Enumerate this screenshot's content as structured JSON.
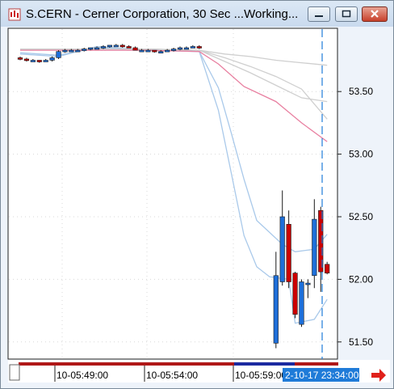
{
  "window": {
    "title": "S.CERN - Cerner Corporation, 30 Sec ...Working...",
    "controls": [
      "minimize",
      "maximize",
      "close"
    ]
  },
  "chart_data": {
    "type": "candlestick",
    "symbol": "S.CERN",
    "interval": "30 Sec",
    "y_ticks": [
      "53.50",
      "53.00",
      "52.50",
      "52.00",
      "51.50"
    ],
    "y_tick_values": [
      53.5,
      53.0,
      52.5,
      52.0,
      51.5
    ],
    "x_ticks": [
      "10-05:49:00",
      "10-05:54:00",
      "10-05:59:00"
    ],
    "cursor_time_label": "2-10-17 23:34:00",
    "ylim": [
      51.3,
      53.9
    ],
    "grid": true,
    "colors": {
      "up": "#1e6fd9",
      "down": "#cc0000",
      "cursor": "#1f7bd8",
      "ma_pink": "#e87fa0",
      "ma_blue": "#a9c9ea",
      "ma_gray": "#cfcfcf"
    },
    "candles": [
      {
        "i": 0,
        "open": 53.77,
        "close": 53.76,
        "high": 53.78,
        "low": 53.75
      },
      {
        "i": 1,
        "open": 53.76,
        "close": 53.75,
        "high": 53.77,
        "low": 53.74
      },
      {
        "i": 2,
        "open": 53.75,
        "close": 53.75,
        "high": 53.76,
        "low": 53.74
      },
      {
        "i": 3,
        "open": 53.75,
        "close": 53.74,
        "high": 53.75,
        "low": 53.73
      },
      {
        "i": 4,
        "open": 53.74,
        "close": 53.75,
        "high": 53.76,
        "low": 53.74
      },
      {
        "i": 5,
        "open": 53.75,
        "close": 53.77,
        "high": 53.78,
        "low": 53.74
      },
      {
        "i": 6,
        "open": 53.77,
        "close": 53.82,
        "high": 53.83,
        "low": 53.76
      },
      {
        "i": 7,
        "open": 53.82,
        "close": 53.83,
        "high": 53.84,
        "low": 53.81
      },
      {
        "i": 8,
        "open": 53.83,
        "close": 53.83,
        "high": 53.84,
        "low": 53.82
      },
      {
        "i": 9,
        "open": 53.83,
        "close": 53.83,
        "high": 53.84,
        "low": 53.83
      },
      {
        "i": 10,
        "open": 53.83,
        "close": 53.84,
        "high": 53.85,
        "low": 53.82
      },
      {
        "i": 11,
        "open": 53.84,
        "close": 53.85,
        "high": 53.85,
        "low": 53.83
      },
      {
        "i": 12,
        "open": 53.85,
        "close": 53.85,
        "high": 53.86,
        "low": 53.84
      },
      {
        "i": 13,
        "open": 53.85,
        "close": 53.86,
        "high": 53.87,
        "low": 53.84
      },
      {
        "i": 14,
        "open": 53.86,
        "close": 53.87,
        "high": 53.87,
        "low": 53.85
      },
      {
        "i": 15,
        "open": 53.87,
        "close": 53.87,
        "high": 53.88,
        "low": 53.86
      },
      {
        "i": 16,
        "open": 53.87,
        "close": 53.86,
        "high": 53.88,
        "low": 53.85
      },
      {
        "i": 17,
        "open": 53.86,
        "close": 53.85,
        "high": 53.87,
        "low": 53.85
      },
      {
        "i": 18,
        "open": 53.85,
        "close": 53.83,
        "high": 53.86,
        "low": 53.83
      },
      {
        "i": 19,
        "open": 53.83,
        "close": 53.83,
        "high": 53.84,
        "low": 53.83
      },
      {
        "i": 20,
        "open": 53.83,
        "close": 53.83,
        "high": 53.84,
        "low": 53.82
      },
      {
        "i": 21,
        "open": 53.83,
        "close": 53.82,
        "high": 53.83,
        "low": 53.81
      },
      {
        "i": 22,
        "open": 53.82,
        "close": 53.82,
        "high": 53.83,
        "low": 53.81
      },
      {
        "i": 23,
        "open": 53.82,
        "close": 53.83,
        "high": 53.84,
        "low": 53.82
      },
      {
        "i": 24,
        "open": 53.83,
        "close": 53.84,
        "high": 53.85,
        "low": 53.82
      },
      {
        "i": 25,
        "open": 53.84,
        "close": 53.85,
        "high": 53.86,
        "low": 53.83
      },
      {
        "i": 26,
        "open": 53.85,
        "close": 53.85,
        "high": 53.86,
        "low": 53.84
      },
      {
        "i": 27,
        "open": 53.85,
        "close": 53.86,
        "high": 53.87,
        "low": 53.85
      },
      {
        "i": 28,
        "open": 53.86,
        "close": 53.85,
        "high": 53.87,
        "low": 53.84
      },
      {
        "i": 40,
        "open": 51.49,
        "close": 52.03,
        "high": 52.22,
        "low": 51.45
      },
      {
        "i": 41,
        "open": 51.98,
        "close": 52.5,
        "high": 52.71,
        "low": 51.95
      },
      {
        "i": 42,
        "open": 52.44,
        "close": 51.98,
        "high": 52.55,
        "low": 51.93
      },
      {
        "i": 43,
        "open": 52.05,
        "close": 51.72,
        "high": 52.06,
        "low": 51.69
      },
      {
        "i": 44,
        "open": 51.64,
        "close": 51.98,
        "high": 52.0,
        "low": 51.62
      },
      {
        "i": 45,
        "open": 51.97,
        "close": 51.97,
        "high": 52.0,
        "low": 51.85
      },
      {
        "i": 46,
        "open": 52.03,
        "close": 52.48,
        "high": 52.64,
        "low": 51.93
      },
      {
        "i": 47,
        "open": 52.55,
        "close": 52.06,
        "high": 52.58,
        "low": 51.9
      },
      {
        "i": 48,
        "open": 52.12,
        "close": 52.05,
        "high": 52.14,
        "low": 52.04
      }
    ],
    "moving_averages": [
      {
        "color": "ma_blue",
        "points": [
          [
            0,
            53.8
          ],
          [
            6,
            53.78
          ],
          [
            12,
            53.86
          ],
          [
            20,
            53.83
          ],
          [
            28,
            53.82
          ],
          [
            31,
            53.35
          ],
          [
            33,
            52.85
          ],
          [
            35,
            52.35
          ],
          [
            37,
            52.1
          ],
          [
            39,
            52.02
          ],
          [
            42,
            52.0
          ],
          [
            43,
            51.65
          ],
          [
            46,
            51.68
          ],
          [
            48,
            51.84
          ]
        ]
      },
      {
        "color": "ma_blue",
        "points": [
          [
            0,
            53.81
          ],
          [
            6,
            53.79
          ],
          [
            12,
            53.85
          ],
          [
            20,
            53.83
          ],
          [
            28,
            53.82
          ],
          [
            31,
            53.53
          ],
          [
            33,
            53.17
          ],
          [
            35,
            52.8
          ],
          [
            37,
            52.47
          ],
          [
            41,
            52.28
          ],
          [
            43,
            52.22
          ],
          [
            46,
            52.24
          ],
          [
            48,
            52.36
          ]
        ]
      },
      {
        "color": "ma_pink",
        "points": [
          [
            0,
            53.83
          ],
          [
            10,
            53.83
          ],
          [
            20,
            53.83
          ],
          [
            28,
            53.82
          ],
          [
            31,
            53.72
          ],
          [
            35,
            53.54
          ],
          [
            40,
            53.42
          ],
          [
            44,
            53.25
          ],
          [
            48,
            53.1
          ]
        ]
      },
      {
        "color": "ma_gray",
        "points": [
          [
            0,
            53.84
          ],
          [
            10,
            53.84
          ],
          [
            20,
            53.84
          ],
          [
            28,
            53.83
          ],
          [
            32,
            53.74
          ],
          [
            36,
            53.65
          ],
          [
            40,
            53.55
          ],
          [
            44,
            53.45
          ],
          [
            48,
            53.42
          ]
        ]
      },
      {
        "color": "ma_gray",
        "points": [
          [
            0,
            53.84
          ],
          [
            10,
            53.84
          ],
          [
            20,
            53.84
          ],
          [
            28,
            53.83
          ],
          [
            32,
            53.77
          ],
          [
            36,
            53.7
          ],
          [
            40,
            53.62
          ],
          [
            44,
            53.52
          ],
          [
            48,
            53.28
          ]
        ]
      },
      {
        "color": "ma_gray",
        "points": [
          [
            0,
            53.84
          ],
          [
            10,
            53.84
          ],
          [
            20,
            53.84
          ],
          [
            28,
            53.83
          ],
          [
            32,
            53.8
          ],
          [
            36,
            53.78
          ],
          [
            40,
            53.75
          ],
          [
            44,
            53.73
          ],
          [
            48,
            53.71
          ]
        ]
      }
    ]
  }
}
